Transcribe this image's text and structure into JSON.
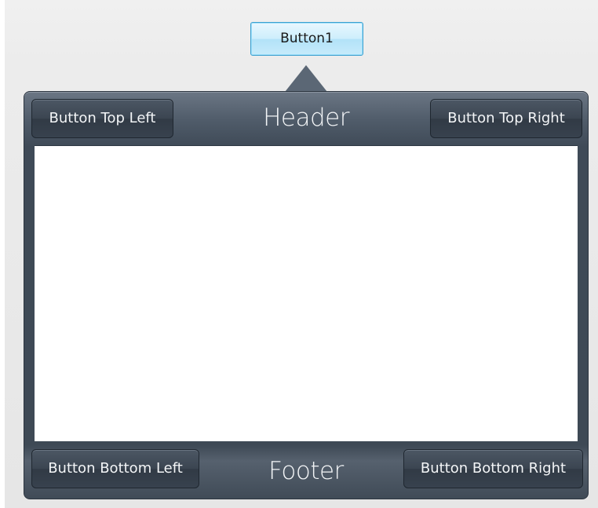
{
  "anchor": {
    "button_label": "Button1"
  },
  "popup": {
    "header": {
      "title": "Header",
      "top_left_label": "Button Top Left",
      "top_right_label": "Button Top Right"
    },
    "footer": {
      "title": "Footer",
      "bottom_left_label": "Button Bottom Left",
      "bottom_right_label": "Button Bottom Right"
    }
  },
  "colors": {
    "popup_background": "#3f4a57",
    "anchor_button_border": "#3c9fcf",
    "anchor_button_fill": "#cdeefc",
    "content_background": "#ffffff"
  }
}
